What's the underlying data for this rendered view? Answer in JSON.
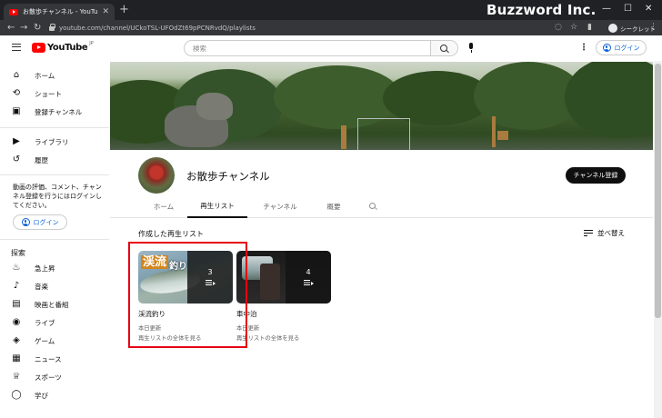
{
  "browser": {
    "tab_title": "お散歩チャンネル - YouTube",
    "url": "youtube.com/channel/UCkoTSL-UFOdZt69pPCNRvdQ/playlists",
    "brand_overlay": "Buzzword Inc.",
    "incognito_label": "シークレット"
  },
  "masthead": {
    "logo_text": "YouTube",
    "logo_region": "JP",
    "search_placeholder": "検索",
    "login_label": "ログイン"
  },
  "sidebar": {
    "primary": [
      {
        "label": "ホーム",
        "icon": "home-icon"
      },
      {
        "label": "ショート",
        "icon": "shorts-icon"
      },
      {
        "label": "登録チャンネル",
        "icon": "subscriptions-icon"
      }
    ],
    "library": [
      {
        "label": "ライブラリ",
        "icon": "library-icon"
      },
      {
        "label": "履歴",
        "icon": "history-icon"
      }
    ],
    "signin_message": "動画の評価、コメント、チャンネル登録を行うにはログインしてください。",
    "login_label": "ログイン",
    "explore_heading": "探索",
    "explore": [
      {
        "label": "急上昇",
        "icon": "trending-icon"
      },
      {
        "label": "音楽",
        "icon": "music-icon"
      },
      {
        "label": "映画と番組",
        "icon": "movies-icon"
      },
      {
        "label": "ライブ",
        "icon": "live-icon"
      },
      {
        "label": "ゲーム",
        "icon": "gaming-icon"
      },
      {
        "label": "ニュース",
        "icon": "news-icon"
      },
      {
        "label": "スポーツ",
        "icon": "sports-icon"
      },
      {
        "label": "学び",
        "icon": "learning-icon"
      }
    ]
  },
  "channel": {
    "name": "お散歩チャンネル",
    "subscribe_label": "チャンネル登録",
    "tabs": [
      {
        "label": "ホーム",
        "active": false
      },
      {
        "label": "再生リスト",
        "active": true
      },
      {
        "label": "チャンネル",
        "active": false
      },
      {
        "label": "概要",
        "active": false
      }
    ]
  },
  "playlists": {
    "section_title": "作成した再生リスト",
    "sort_label": "並べ替え",
    "items": [
      {
        "title": "渓流釣り",
        "count": "3",
        "updated": "本日更新",
        "view_all": "再生リストの全体を見る",
        "thumb_caption_main": "渓流",
        "thumb_caption_sub": "釣り"
      },
      {
        "title": "車中泊",
        "count": "4",
        "updated": "本日更新",
        "view_all": "再生リストの全体を見る"
      }
    ]
  },
  "colors": {
    "youtube_red": "#ff0000",
    "link_blue": "#065fd4",
    "highlight_border": "#e60012",
    "subscribe_bg": "#0f0f0f"
  }
}
